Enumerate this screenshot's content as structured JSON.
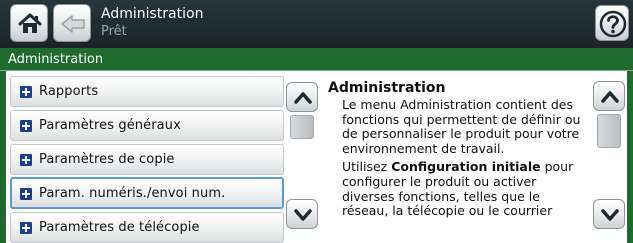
{
  "header": {
    "title": "Administration",
    "status": "Prêt"
  },
  "section": {
    "title": "Administration"
  },
  "menu": {
    "items": [
      {
        "label": "Rapports",
        "selected": false
      },
      {
        "label": "Paramètres généraux",
        "selected": false
      },
      {
        "label": "Paramètres de copie",
        "selected": false
      },
      {
        "label": "Param. numéris./envoi num.",
        "selected": true
      },
      {
        "label": "Paramètres de télécopie",
        "selected": false
      }
    ]
  },
  "detail": {
    "title": "Administration",
    "paragraph1": "Le menu Administration contient des fonctions qui permettent de définir ou de personnaliser le produit pour votre environnement de travail.",
    "paragraph2_before": "Utilisez ",
    "paragraph2_bold": "Configuration initiale",
    "paragraph2_after": " pour configurer le produit ou activer diverses fonctions, telles que le réseau, la télécopie ou le courrier"
  },
  "icons": {
    "home": "home-icon",
    "back": "back-arrow-icon",
    "help": "help-icon",
    "item": "plus-box-icon",
    "scroll_up": "chevron-up-icon",
    "scroll_down": "chevron-down-icon"
  },
  "colors": {
    "topbar": "#1f2c31",
    "section_header": "#1f6a2d",
    "item_icon": "#1a3f91",
    "selected_border": "#5b9bd1"
  }
}
